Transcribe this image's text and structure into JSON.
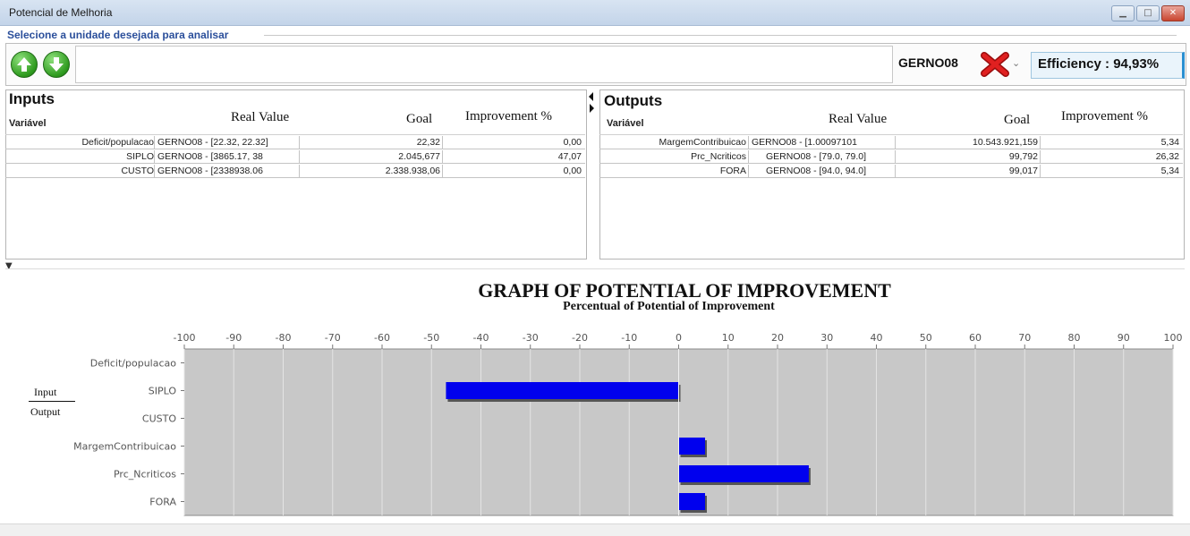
{
  "window": {
    "title": "Potencial de Melhoria",
    "subtitle": "Selecione a unidade desejada para analisar"
  },
  "toolbar": {
    "up_icon": "arrow-up-icon",
    "down_icon": "arrow-down-icon",
    "unit": "GERNO08",
    "efficiency": "Efficiency : 94,93%"
  },
  "inputs": {
    "title": "Inputs",
    "headers": [
      "Variável",
      "Real Value",
      "Goal",
      "Improvement  %"
    ],
    "rows": [
      {
        "variable": "Deficit/populacao",
        "real": "GERNO08 - [22.32, 22.32]",
        "goal": "22,32",
        "improvement": "0,00"
      },
      {
        "variable": "SIPLO",
        "real": "GERNO08 - [3865.17, 38",
        "goal": "2.045,677",
        "improvement": "47,07"
      },
      {
        "variable": "CUSTO",
        "real": "GERNO08 - [2338938.06",
        "goal": "2.338.938,06",
        "improvement": "0,00"
      }
    ]
  },
  "outputs": {
    "title": "Outputs",
    "headers": [
      "Variável",
      "Real Value",
      "Goal",
      "Improvement  %"
    ],
    "rows": [
      {
        "variable": "MargemContribuicao",
        "real": "GERNO08 - [1.00097101",
        "goal": "10.543.921,159",
        "improvement": "5,34"
      },
      {
        "variable": "Prc_Ncriticos",
        "real": "GERNO08 - [79.0, 79.0]",
        "goal": "99,792",
        "improvement": "26,32"
      },
      {
        "variable": "FORA",
        "real": "GERNO08 - [94.0, 94.0]",
        "goal": "99,017",
        "improvement": "5,34"
      }
    ]
  },
  "legend": {
    "input": "Input",
    "output": "Output"
  },
  "colors": {
    "bar": "#0000ee",
    "plot_bg": "#c8c8c8",
    "accent": "#2a8fd1"
  },
  "chart_data": {
    "type": "bar",
    "orientation": "horizontal",
    "title": "GRAPH OF POTENTIAL OF IMPROVEMENT",
    "subtitle": "Percentual of Potential of Improvement",
    "categories": [
      "Deficit/populacao",
      "SIPLO",
      "CUSTO",
      "MargemContribuicao",
      "Prc_Ncriticos",
      "FORA"
    ],
    "values": [
      0,
      -47.07,
      0,
      5.34,
      26.32,
      5.34
    ],
    "xlim": [
      -100,
      100
    ],
    "xticks": [
      -100,
      -90,
      -80,
      -70,
      -60,
      -50,
      -40,
      -30,
      -20,
      -10,
      0,
      10,
      20,
      30,
      40,
      50,
      60,
      70,
      80,
      90,
      100
    ],
    "xaxis_position": "top",
    "grid": true
  }
}
